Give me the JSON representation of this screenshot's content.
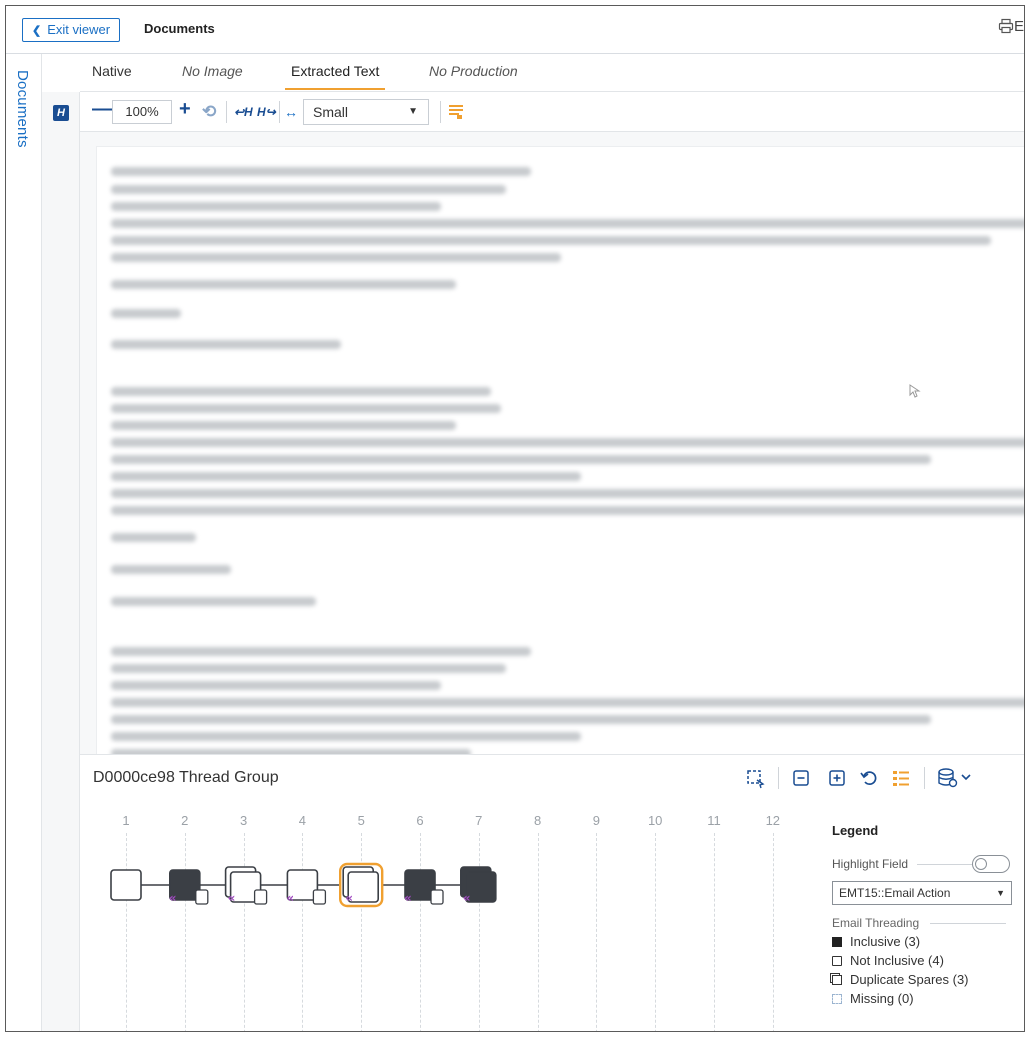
{
  "header": {
    "exit_label": "Exit viewer",
    "title": "Documents",
    "right_label": "E"
  },
  "rail": {
    "label": "Documents"
  },
  "tabs": [
    {
      "label": "Native",
      "style": "normal"
    },
    {
      "label": "No Image",
      "style": "italic"
    },
    {
      "label": "Extracted Text",
      "style": "active"
    },
    {
      "label": "No Production",
      "style": "italic"
    }
  ],
  "toolbar": {
    "zoom": "100%",
    "size_selected": "Small"
  },
  "thread": {
    "title": "D0000ce98 Thread Group",
    "columns": [
      "1",
      "2",
      "3",
      "4",
      "5",
      "6",
      "7",
      "8",
      "9",
      "10",
      "11",
      "12"
    ],
    "nodes": [
      {
        "column": 1,
        "kind": "not_inclusive"
      },
      {
        "column": 2,
        "kind": "inclusive",
        "has_duplicate_spare": true
      },
      {
        "column": 3,
        "kind": "duplicate_spares",
        "has_duplicate_spare": true
      },
      {
        "column": 4,
        "kind": "not_inclusive",
        "has_duplicate_spare": true
      },
      {
        "column": 5,
        "kind": "duplicate_spares",
        "selected": true
      },
      {
        "column": 6,
        "kind": "inclusive",
        "has_duplicate_spare": true
      },
      {
        "column": 7,
        "kind": "inclusive_duplicate"
      }
    ]
  },
  "legend": {
    "title": "Legend",
    "highlight_label": "Highlight Field",
    "field_selected": "EMT15::Email Action",
    "section_label": "Email Threading",
    "items": [
      {
        "label": "Inclusive (3)"
      },
      {
        "label": "Not Inclusive (4)"
      },
      {
        "label": "Duplicate Spares (3)"
      },
      {
        "label": "Missing (0)"
      }
    ]
  },
  "colors": {
    "accent_blue": "#1a6fc4",
    "accent_orange": "#f0a030",
    "node_dark": "#3b3f45",
    "spare_marker": "#a04ac0"
  }
}
